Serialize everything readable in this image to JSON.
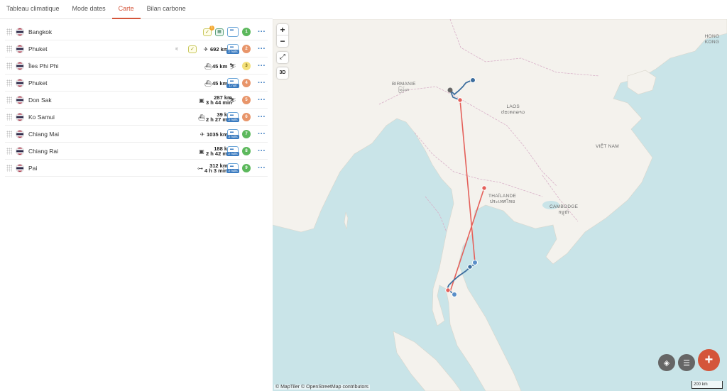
{
  "tabs": [
    {
      "label": "Tableau climatique",
      "active": false
    },
    {
      "label": "Mode dates",
      "active": false
    },
    {
      "label": "Carte",
      "active": true
    },
    {
      "label": "Bilan carbone",
      "active": false
    }
  ],
  "stops": [
    {
      "city": "Bangkok",
      "number": "1",
      "number_color": "#5cb85c"
    },
    {
      "city": "Phuket",
      "number": "2",
      "number_color": "#e8956a",
      "transport_distance": "692 km",
      "nights": "2 nuits"
    },
    {
      "city": "Îles Phi Phi",
      "number": "3",
      "number_color": "#f4e07a",
      "transport_distance": "45 km"
    },
    {
      "city": "Phuket",
      "number": "4",
      "number_color": "#e8956a",
      "transport_distance": "45 km",
      "nights": "1 nuit"
    },
    {
      "city": "Don Sak",
      "number": "5",
      "number_color": "#e8956a",
      "transport_distance": "287 km",
      "transport_time": "3 h 44 min"
    },
    {
      "city": "Ko Samui",
      "number": "6",
      "number_color": "#e8956a",
      "transport_distance": "39 km",
      "transport_time": "2 h 27 min",
      "nights": "3 nuits"
    },
    {
      "city": "Chiang Mai",
      "number": "7",
      "number_color": "#5cb85c",
      "transport_distance": "1035 km",
      "nights": "3 nuits"
    },
    {
      "city": "Chiang Rai",
      "number": "8",
      "number_color": "#5cb85c",
      "transport_distance": "188 km",
      "transport_time": "2 h 42 min",
      "nights": "2 nuits"
    },
    {
      "city": "Pai",
      "number": "9",
      "number_color": "#5cb85c",
      "transport_distance": "312 km",
      "transport_time": "4 h 3 min",
      "nights": "3 nuits"
    }
  ],
  "row_badge": "1",
  "map": {
    "zoom_in": "+",
    "zoom_out": "−",
    "btn_3d": "3D",
    "labels": {
      "birmanie": "BIRMANIE",
      "birmanie_local": "မြန်မာ",
      "laos": "LAOS",
      "laos_local": "ປະເທດລາວ",
      "vietnam": "VIỆT NAM",
      "thailande": "THAÏLANDE",
      "thailande_local": "ประเทศไทย",
      "cambodge": "CAMBODGE",
      "cambodge_local": "កម្ពុជា",
      "hongkong": "HONG KONG"
    },
    "attribution": "© MapTiler © OpenStreetMap contributors",
    "scale": "200 km",
    "fab_add": "+"
  },
  "colors": {
    "accent": "#d4553a",
    "flight_line": "#e4605a",
    "road_line": "#3d6e9e",
    "land": "#f4f2ed",
    "water": "#c9e4e8"
  }
}
